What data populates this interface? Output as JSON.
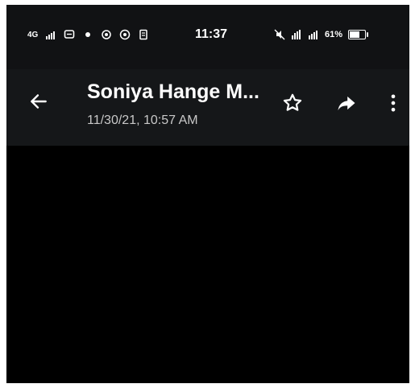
{
  "status_bar": {
    "network": "4G",
    "time": "11:37",
    "battery_percent": "61%",
    "battery_level": 0.61
  },
  "app_bar": {
    "title": "Soniya Hange M...",
    "subtitle": "11/30/21, 10:57 AM",
    "icons": [
      "back-arrow-icon",
      "star-icon",
      "share-forward-icon",
      "more-vert-icon"
    ]
  },
  "colors": {
    "status_bar_bg": "#111214",
    "app_bar_bg": "#151719",
    "content_bg": "#000000",
    "text_primary": "#ffffff",
    "text_secondary": "#c8c8c8"
  }
}
